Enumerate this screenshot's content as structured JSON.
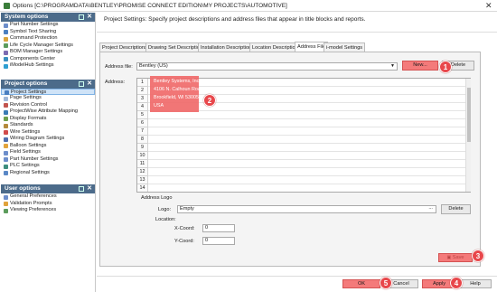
{
  "window": {
    "title": "Options [C:\\PROGRAMDATA\\BENTLEY\\PROMISE CONNECT EDITION\\MY PROJECTS\\AUTOMOTIVE]",
    "close": "✕"
  },
  "sidebar": {
    "system": {
      "header": "System options",
      "items": [
        "Part Number Settings",
        "Symbol Text Sharing",
        "Command Protection",
        "Life Cycle Manager Settings",
        "BOM Manager Settings",
        "Components Center",
        "iModelHub Settings"
      ]
    },
    "project": {
      "header": "Project options",
      "items": [
        "Project Settings",
        "Page Settings",
        "Revision Control",
        "ProjectWise Attribute Mapping",
        "Display Formats",
        "Standards",
        "Wire Settings",
        "Wiring Diagram Settings",
        "Balloon Settings",
        "Field Settings",
        "Part Number Settings",
        "PLC Settings",
        "Regional Settings"
      ]
    },
    "user": {
      "header": "User options",
      "items": [
        "General Preferences",
        "Validation Prompts",
        "Viewing Preferences"
      ]
    }
  },
  "header": {
    "text": "Project Settings: Specify project descriptions and address files that appear in title blocks and reports."
  },
  "tabs": [
    {
      "label": "Project Descriptions"
    },
    {
      "label": "Drawing Set Descriptions"
    },
    {
      "label": "Installation Descriptions"
    },
    {
      "label": "Location Descriptions"
    },
    {
      "label": "Address File"
    },
    {
      "label": "i-model Settings"
    }
  ],
  "address_file": {
    "label": "Address file:",
    "value": "Bentley (US)",
    "new_label": "New...",
    "delete_label": "Delete"
  },
  "address": {
    "label": "Address:",
    "line_numbers": [
      "1",
      "2",
      "3",
      "4",
      "5",
      "6",
      "7",
      "8",
      "9",
      "10",
      "11",
      "12",
      "13",
      "14"
    ],
    "lines": [
      "Bentley Systems, Inc.",
      "4106 N. Calhoun Road,",
      "Brookfield, WI 53005",
      "USA"
    ]
  },
  "logo": {
    "group_label": "Address Logo",
    "logo_label": "Logo:",
    "logo_value": "Empty",
    "browse": "...",
    "delete_label": "Delete",
    "location_label": "Location:",
    "xcoord_label": "X-Coord:",
    "xcoord_value": "0",
    "ycoord_label": "Y-Coord:",
    "ycoord_value": "0"
  },
  "save_label": "Save",
  "buttons": {
    "ok": "OK",
    "cancel": "Cancel",
    "apply": "Apply",
    "help": "Help"
  },
  "callouts": [
    "1",
    "2",
    "3",
    "4",
    "5"
  ],
  "colors": {
    "highlight": "#f06a6a",
    "callout": "#e8474b",
    "group_header": "#4c6b8a",
    "selected": "#cfe3f7"
  }
}
